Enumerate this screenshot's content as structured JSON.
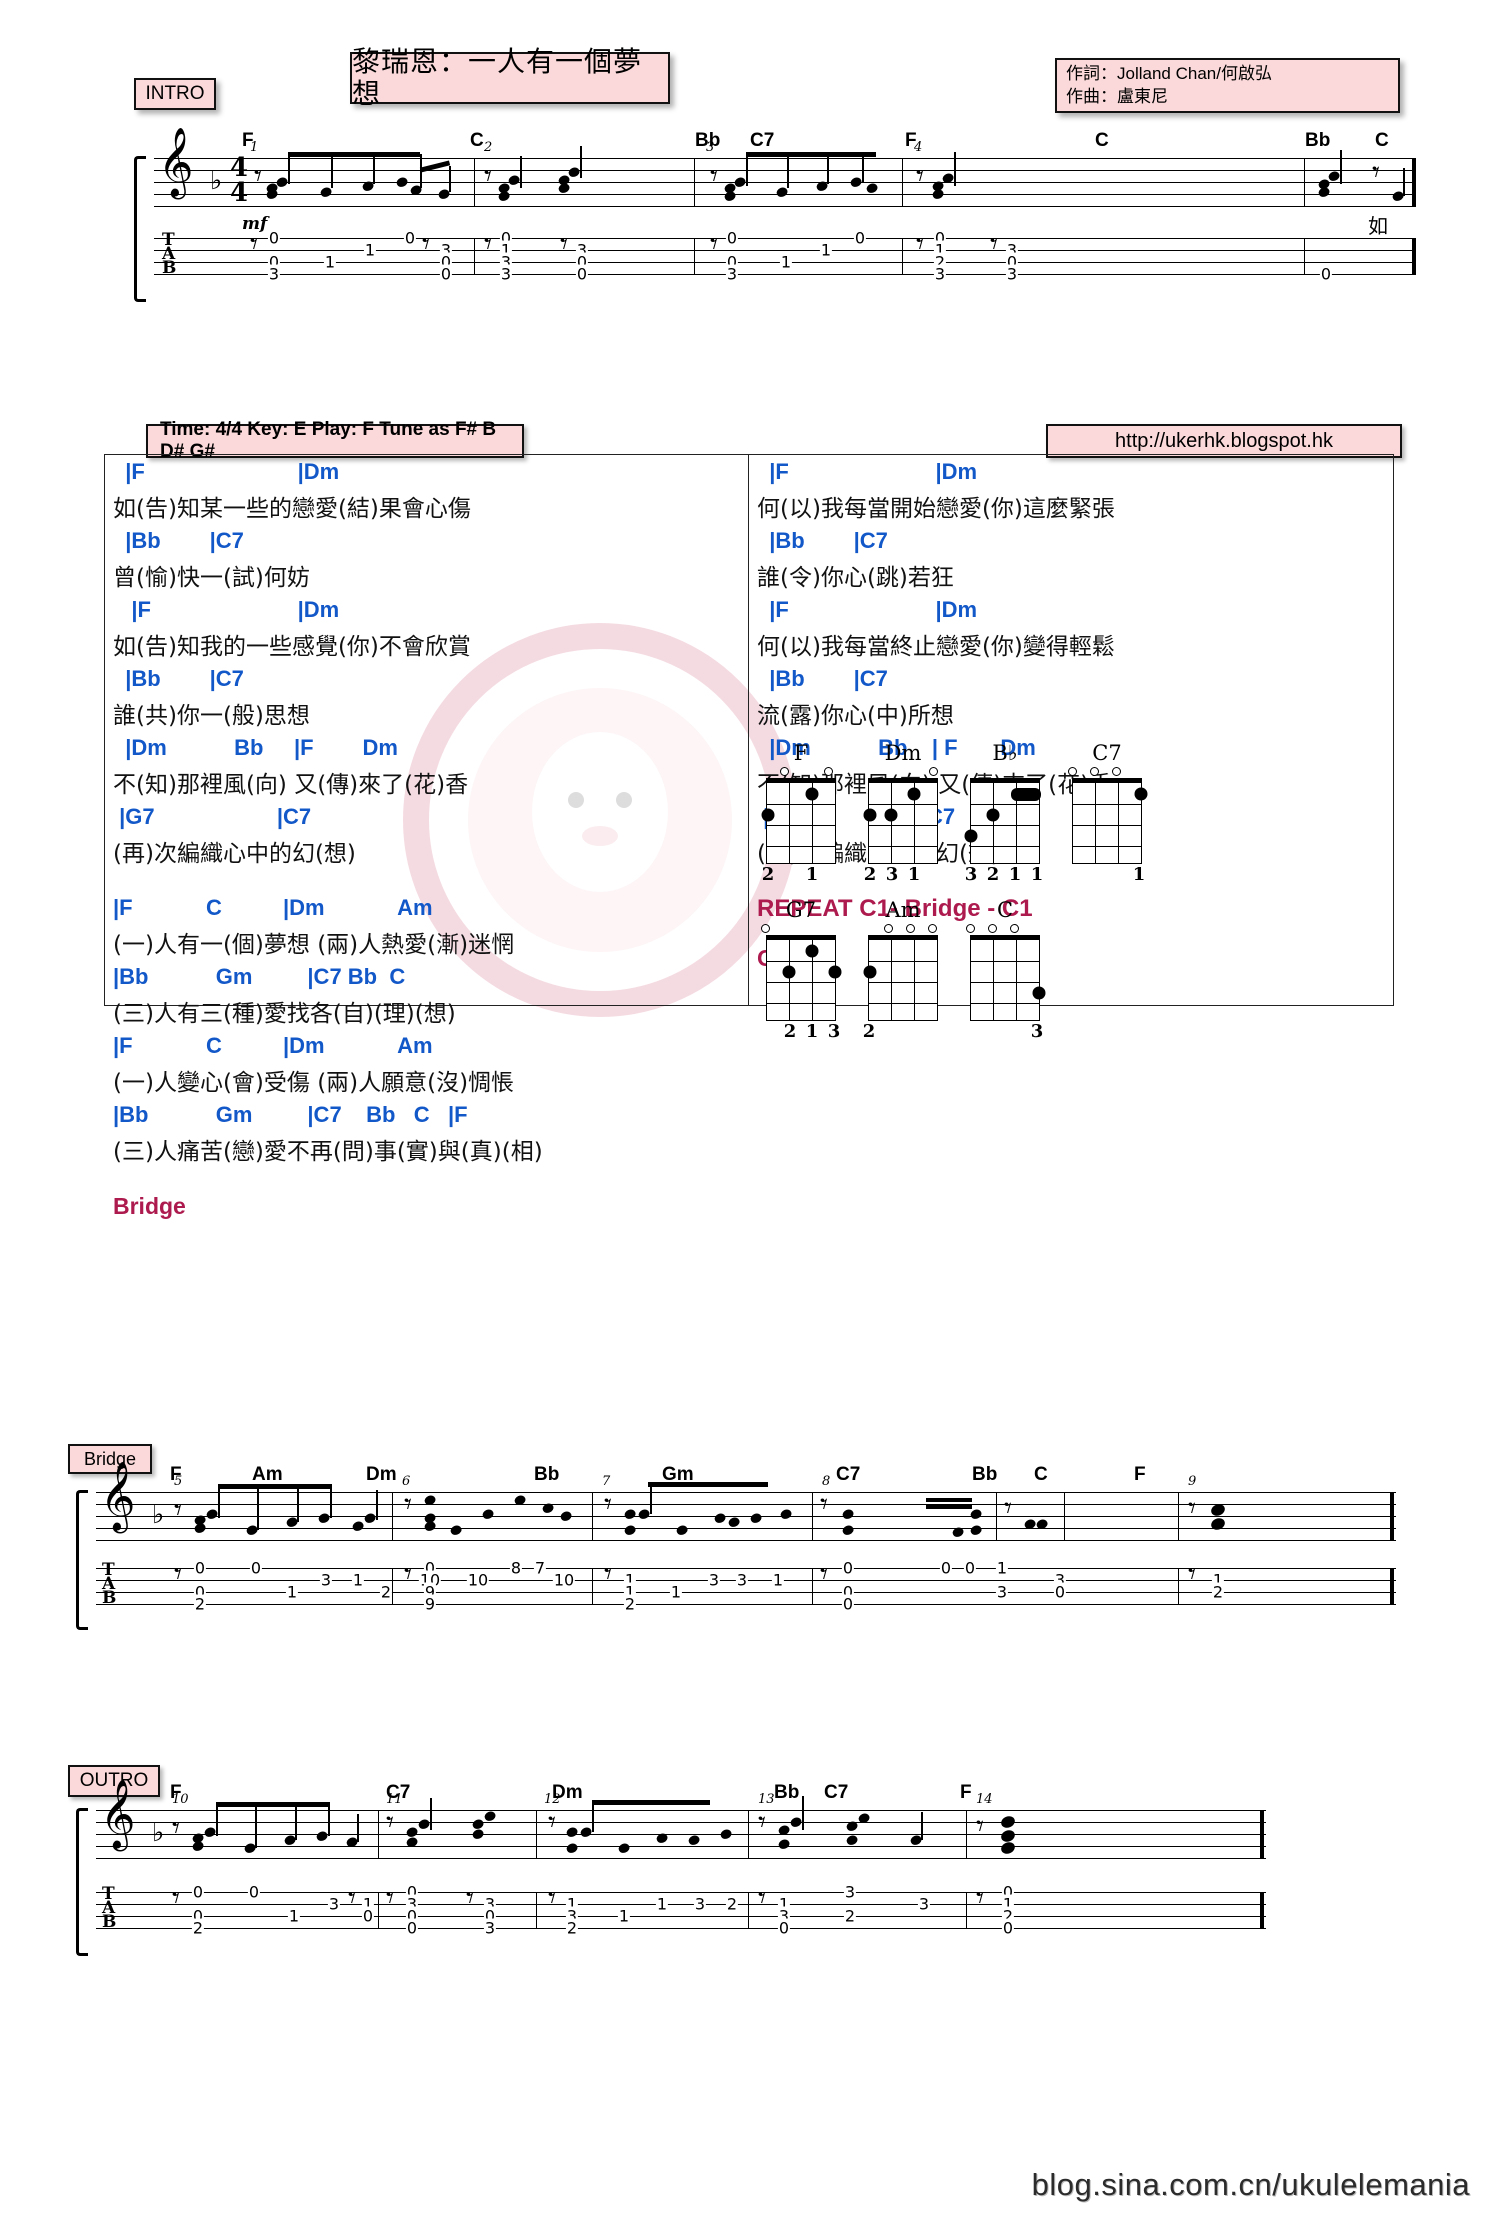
{
  "title": "黎瑞恩：一人有一個夢想",
  "credits": {
    "lyricist": "作詞：Jolland Chan/何啟弘",
    "composer": "作曲：盧東尼"
  },
  "labels": {
    "intro": "INTRO",
    "bridge": "Bridge",
    "outro": "OUTRO",
    "bridge_section": "Bridge",
    "outro_section": "Outro",
    "repeat": "REPEAT C1- Bridge - C1"
  },
  "info": {
    "time_key": "Time: 4/4 Key: E  Play: F  Tune as F# B D# G#",
    "url": "http://ukerhk.blogspot.hk"
  },
  "footer": "blog.sina.com.cn/ukulelemania",
  "colors": {
    "pink": "#fbd9da",
    "chord_blue": "#1358c9",
    "section_red": "#ad1b4e"
  },
  "intro_staff": {
    "chords": [
      "F",
      "C",
      "Bb",
      "C7",
      "F",
      "C",
      "Bb",
      "C"
    ],
    "measures": [
      "1",
      "2",
      "3",
      "4"
    ],
    "dynamic": "mf",
    "pickup_lyric": "如",
    "tab_label": [
      "T",
      "A",
      "B"
    ],
    "tab_numbers": [
      "0",
      "1",
      "0",
      "0",
      "3",
      "1",
      "3",
      "1",
      "0",
      "3",
      "0",
      "1",
      "0",
      "0",
      "2",
      "3",
      "3",
      "0",
      "1",
      "0",
      "3",
      "2",
      "3",
      "0"
    ]
  },
  "bridge_staff": {
    "chords": [
      "F",
      "Am",
      "Dm",
      "Bb",
      "Gm",
      "C7",
      "Bb",
      "C",
      "F"
    ],
    "measures": [
      "5",
      "6",
      "7",
      "8",
      "9"
    ],
    "tab_label": [
      "T",
      "A",
      "B"
    ],
    "tab_numbers": [
      "0",
      "0",
      "1",
      "3",
      "1",
      "0",
      "2",
      "10",
      "8",
      "7",
      "10",
      "8",
      "9",
      "1",
      "1",
      "1",
      "3",
      "1",
      "2",
      "0",
      "0",
      "0",
      "1",
      "3",
      "3",
      "0",
      "1",
      "2"
    ]
  },
  "outro_staff": {
    "chords": [
      "F",
      "C7",
      "Dm",
      "Bb",
      "C7",
      "F"
    ],
    "measures": [
      "10",
      "11",
      "12",
      "13",
      "14"
    ],
    "tab_label": [
      "T",
      "A",
      "B"
    ],
    "tab_numbers": [
      "0",
      "0",
      "1",
      "3",
      "1",
      "2",
      "0",
      "3",
      "3",
      "0",
      "0",
      "1",
      "3",
      "1",
      "2",
      "1",
      "3",
      "2",
      "3",
      "0",
      "2"
    ]
  },
  "verse": {
    "left": [
      {
        "chord": "  |F                         |Dm",
        "lyric": "如(告)知某一些的戀愛(結)果會心傷"
      },
      {
        "chord": "  |Bb        |C7",
        "lyric": "曾(愉)快一(試)何妨"
      },
      {
        "chord": "   |F                        |Dm",
        "lyric": "如(告)知我的一些感覺(你)不會欣賞"
      },
      {
        "chord": "  |Bb        |C7",
        "lyric": "誰(共)你一(般)思想"
      },
      {
        "chord": "  |Dm           Bb     |F        Dm",
        "lyric": "不(知)那裡風(向) 又(傳)來了(花)香"
      },
      {
        "chord": " |G7                    |C7",
        "lyric": "(再)次編織心中的幻(想)"
      }
    ],
    "right": [
      {
        "chord": "  |F                        |Dm",
        "lyric": "何(以)我每當開始戀愛(你)這麼緊張"
      },
      {
        "chord": "  |Bb        |C7",
        "lyric": "誰(令)你心(跳)若狂"
      },
      {
        "chord": "  |F                        |Dm",
        "lyric": "何(以)我每當終止戀愛(你)變得輕鬆"
      },
      {
        "chord": "  |Bb        |C7",
        "lyric": "流(露)你心(中)所想"
      },
      {
        "chord": "  |Dm           Bb    | F       Dm",
        "lyric": "不(知)那裡風(向) 又(傳)來了(花)香"
      },
      {
        "chord": " |G7                    |C7",
        "lyric": "(再)次編織心中的幻(想)"
      }
    ]
  },
  "chorus": [
    {
      "chord": "|F            C          |Dm            Am",
      "lyric": "(一)人有一(個)夢想 (兩)人熱愛(漸)迷惘"
    },
    {
      "chord": "|Bb           Gm         |C7 Bb  C",
      "lyric": "(三)人有三(種)愛找各(自)(理)(想)"
    },
    {
      "chord": "|F            C          |Dm            Am",
      "lyric": "(一)人變心(會)受傷 (兩)人願意(沒)惆悵"
    },
    {
      "chord": "|Bb           Gm         |C7    Bb   C   |F",
      "lyric": "(三)人痛苦(戀)愛不再(問)事(實)與(真)(相)"
    }
  ],
  "chord_diagrams": [
    {
      "name": "F",
      "fingers": "2   1"
    },
    {
      "name": "Dm",
      "fingers": "2 3 1"
    },
    {
      "name": "B♭",
      "fingers": "3 2 1 1"
    },
    {
      "name": "C7",
      "fingers": "1"
    },
    {
      "name": "G7",
      "fingers": "2 1 3"
    },
    {
      "name": "Am",
      "fingers": "2"
    },
    {
      "name": "C",
      "fingers": "3"
    }
  ]
}
